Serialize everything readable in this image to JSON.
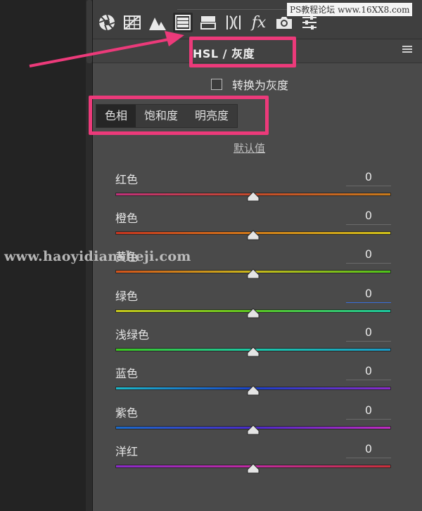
{
  "toolbar": {
    "tools": [
      {
        "name": "basic-icon",
        "active": false
      },
      {
        "name": "tone-curve-icon",
        "active": false
      },
      {
        "name": "detail-icon",
        "active": false
      },
      {
        "name": "hsl-icon",
        "active": true
      },
      {
        "name": "split-toning-icon",
        "active": false
      },
      {
        "name": "lens-corrections-icon",
        "active": false
      },
      {
        "name": "effects-icon",
        "active": false
      },
      {
        "name": "camera-calibration-icon",
        "active": false
      },
      {
        "name": "presets-icon",
        "active": false
      }
    ],
    "effects_glyph": "fx"
  },
  "panel": {
    "title": "HSL / 灰度",
    "convert_grayscale_label": "转换为灰度",
    "convert_grayscale_checked": false,
    "tabs": [
      "色相",
      "饱和度",
      "明亮度"
    ],
    "active_tab": 0,
    "defaults_link": "默认值"
  },
  "sliders": [
    {
      "label": "红色",
      "value": "0",
      "focused": false,
      "position": 0.5,
      "gradient": [
        "#c0307a",
        "#c44a2a",
        "#c87a1a"
      ]
    },
    {
      "label": "橙色",
      "value": "0",
      "focused": false,
      "position": 0.5,
      "gradient": [
        "#c8341e",
        "#d27a18",
        "#d2c418"
      ]
    },
    {
      "label": "黄色",
      "value": "0",
      "focused": false,
      "position": 0.5,
      "gradient": [
        "#d2521a",
        "#c8b81a",
        "#4cc21a"
      ]
    },
    {
      "label": "绿色",
      "value": "0",
      "focused": true,
      "position": 0.5,
      "gradient": [
        "#c8c81a",
        "#5ac81e",
        "#1ac8a0"
      ]
    },
    {
      "label": "浅绿色",
      "value": "0",
      "focused": false,
      "position": 0.5,
      "gradient": [
        "#3cc81e",
        "#1ac8a8",
        "#1a9ac8"
      ]
    },
    {
      "label": "蓝色",
      "value": "0",
      "focused": false,
      "position": 0.5,
      "gradient": [
        "#1ab8c8",
        "#1a40c8",
        "#8a2ac8"
      ]
    },
    {
      "label": "紫色",
      "value": "0",
      "focused": false,
      "position": 0.5,
      "gradient": [
        "#1a6ac8",
        "#4a2ac8",
        "#c02ac0"
      ]
    },
    {
      "label": "洋红",
      "value": "0",
      "focused": false,
      "position": 0.5,
      "gradient": [
        "#8a2ac8",
        "#c02aa0",
        "#c8303a"
      ]
    }
  ],
  "watermarks": {
    "top_right": "PS教程论坛 www.16XX8.com",
    "middle": "www.haoyidiansheji.com"
  },
  "colors": {
    "annotation": "#ec3a7a",
    "panel_bg": "#4a4a4a",
    "active_tab_bg": "#262626"
  }
}
